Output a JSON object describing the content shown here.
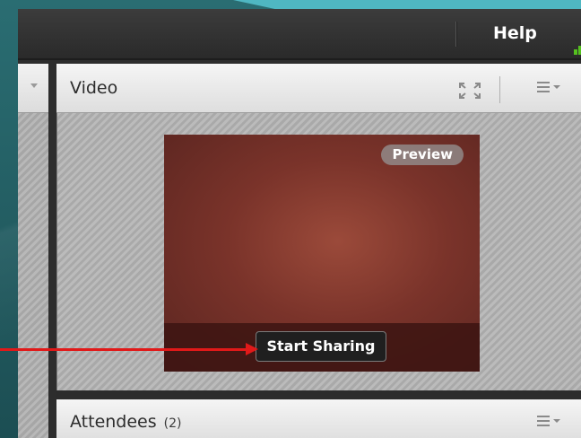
{
  "toolbar": {
    "help_label": "Help"
  },
  "video_pod": {
    "title": "Video",
    "preview_badge": "Preview",
    "start_sharing_label": "Start Sharing"
  },
  "attendees_pod": {
    "title": "Attendees",
    "count": "(2)"
  },
  "colors": {
    "accent_teal": "#4fb7c2",
    "signal_green": "#55c11f",
    "annotation_arrow": "#e11919"
  },
  "icons": [
    "signal-strength-icon",
    "fullscreen-icon",
    "pod-menu-icon",
    "chevron-down-icon"
  ]
}
